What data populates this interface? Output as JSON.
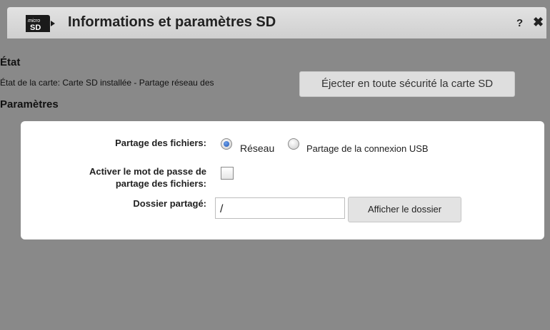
{
  "dialog": {
    "title": "Informations et paramètres SD",
    "help_label": "?",
    "close_label": "✖",
    "icon": "microsd-card-icon"
  },
  "etat": {
    "heading": "État",
    "status_text": "État de la carte: Carte SD installée - Partage réseau des",
    "eject_button": "Éjecter en toute sécurité la carte SD"
  },
  "parametres": {
    "heading": "Paramètres",
    "file_sharing_label": "Partage des fichiers:",
    "file_sharing_options": [
      {
        "label": "Réseau",
        "selected": true
      },
      {
        "label": "Partage de la connexion USB",
        "selected": false
      }
    ],
    "password_label_line1": "Activer le mot de passe de",
    "password_label_line2": "partage des fichiers:",
    "password_enabled": false,
    "shared_folder_label": "Dossier partagé:",
    "shared_folder_value": "/",
    "show_folder_button": "Afficher le dossier"
  },
  "colors": {
    "overlay": "#898989",
    "titlebar": "#d9d9d9",
    "panel": "#ffffff",
    "radio_selected": "#1f56b8"
  }
}
